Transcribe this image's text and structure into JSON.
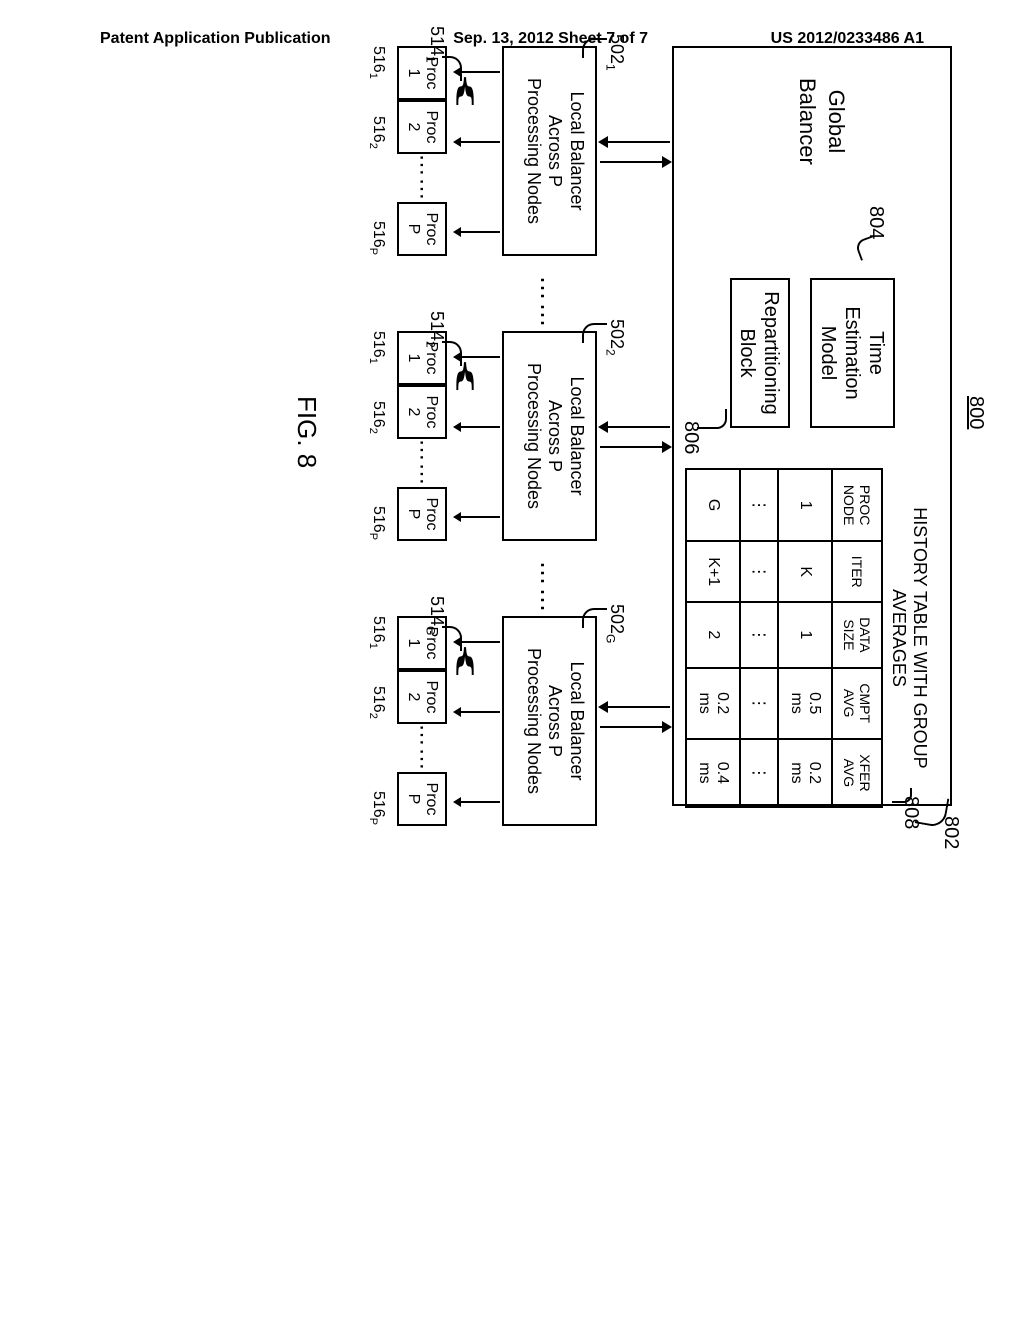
{
  "header": {
    "left": "Patent Application Publication",
    "center": "Sep. 13, 2012  Sheet 7 of 7",
    "right": "US 2012/0233486 A1"
  },
  "refs": {
    "r800": "800",
    "r802": "802",
    "r804": "804",
    "r806": "806",
    "r808": "808"
  },
  "global_balancer": {
    "title_line1": "Global",
    "title_line2": "Balancer",
    "time_est_line1": "Time",
    "time_est_line2": "Estimation",
    "time_est_line3": "Model",
    "repart_line1": "Repartitioning",
    "repart_line2": "Block"
  },
  "history": {
    "title": "HISTORY TABLE WITH GROUP AVERAGES",
    "headers": {
      "h1": "PROC\nNODE",
      "h2": "ITER",
      "h3": "DATA\nSIZE",
      "h4": "CMPT\nAVG",
      "h5": "XFER\nAVG"
    },
    "rows": [
      {
        "c1": "1",
        "c2": "K",
        "c3": "1",
        "c4": "0.5\nms",
        "c5": "0.2\nms"
      },
      {
        "c1": "⋮",
        "c2": "⋮",
        "c3": "⋮",
        "c4": "⋮",
        "c5": "⋮"
      },
      {
        "c1": "G",
        "c2": "K+1",
        "c3": "2",
        "c4": "0.2\nms",
        "c5": "0.4\nms"
      }
    ]
  },
  "local": {
    "line1": "Local Balancer",
    "line2": "Across P",
    "line3": "Processing Nodes",
    "proc1": "Proc\n1",
    "proc2": "Proc\n2",
    "procP": "Proc\nP",
    "dots": "⋯⋯"
  },
  "group_refs": {
    "g1_502": "502",
    "g1_502_sub": "1",
    "g2_502": "502",
    "g2_502_sub": "2",
    "gG_502": "502",
    "gG_502_sub": "G",
    "g1_514": "514",
    "g1_514_sub": "1",
    "g2_514": "514",
    "g2_514_sub": "2",
    "gG_514": "514",
    "gG_514_sub": "G",
    "p516_1": "516",
    "p516_1_sub": "1",
    "p516_2": "516",
    "p516_2_sub": "2",
    "p516_P": "516",
    "p516_P_sub": "P"
  },
  "fig": "FIG. 8",
  "mid_dots": "⋯⋯"
}
